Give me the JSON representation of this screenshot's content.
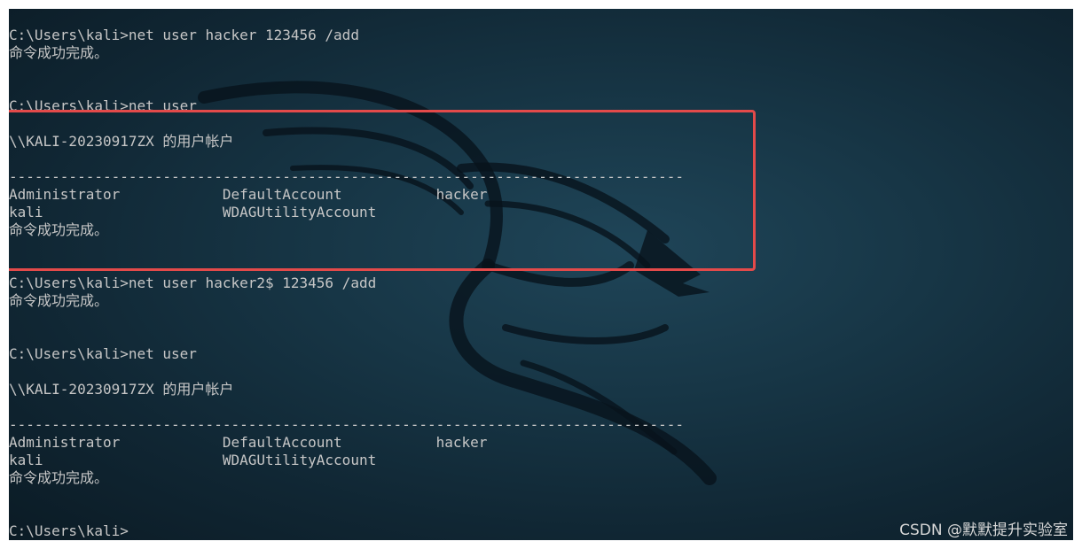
{
  "terminal": {
    "lines": [
      "C:\\Users\\kali>net user hacker 123456 /add",
      "命令成功完成。",
      "",
      "",
      "C:\\Users\\kali>net user",
      "",
      "\\\\KALI-20230917ZX 的用户帐户",
      "",
      "-------------------------------------------------------------------------------",
      "Administrator            DefaultAccount           hacker",
      "kali                     WDAGUtilityAccount",
      "命令成功完成。",
      "",
      "",
      "C:\\Users\\kali>net user hacker2$ 123456 /add",
      "命令成功完成。",
      "",
      "",
      "C:\\Users\\kali>net user",
      "",
      "\\\\KALI-20230917ZX 的用户帐户",
      "",
      "-------------------------------------------------------------------------------",
      "Administrator            DefaultAccount           hacker",
      "kali                     WDAGUtilityAccount",
      "命令成功完成。",
      "",
      "",
      "C:\\Users\\kali>"
    ]
  },
  "watermark": "CSDN @默默提升实验室",
  "colors": {
    "background": "#173646",
    "text": "#c6c6c6",
    "highlight_border": "#e34a4a"
  },
  "icons": {
    "background_logo": "kali-dragon-icon"
  }
}
